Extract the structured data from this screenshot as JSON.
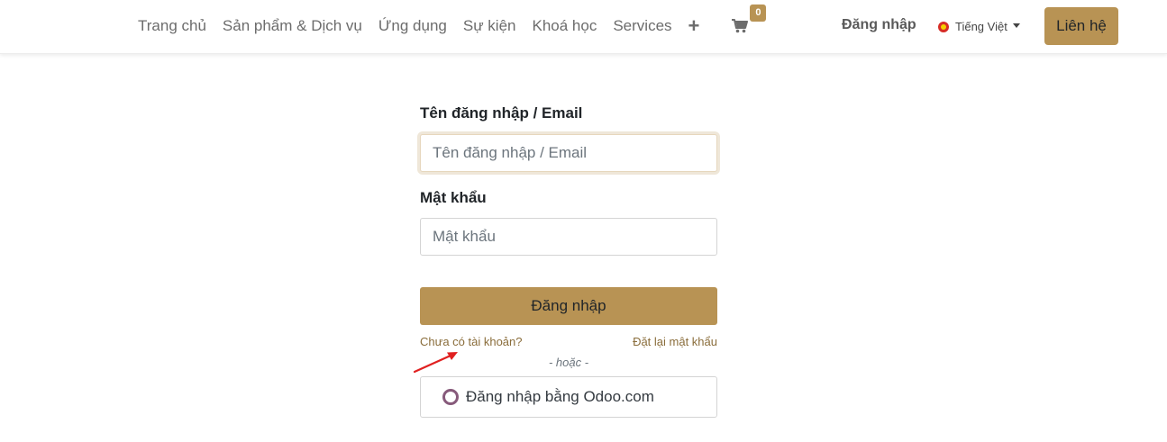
{
  "header": {
    "nav": [
      {
        "label": "Trang chủ"
      },
      {
        "label": "Sản phẩm & Dịch vụ"
      },
      {
        "label": "Ứng dụng"
      },
      {
        "label": "Sự kiện"
      },
      {
        "label": "Khoá học"
      },
      {
        "label": "Services"
      }
    ],
    "plus_icon": "plus-icon",
    "cart": {
      "icon": "cart-icon",
      "count": "0"
    },
    "login_label": "Đăng nhập",
    "language": {
      "label": "Tiếng Việt",
      "flag_icon": "vietnam-flag-icon"
    },
    "contact_label": "Liên hệ"
  },
  "form": {
    "username": {
      "label": "Tên đăng nhập / Email",
      "placeholder": "Tên đăng nhập / Email",
      "value": ""
    },
    "password": {
      "label": "Mật khẩu",
      "placeholder": "Mật khẩu",
      "value": ""
    },
    "submit_label": "Đăng nhập",
    "signup_link": "Chưa có tài khoản?",
    "reset_link": "Đặt lại mật khẩu",
    "or_text": "- hoặc -",
    "oauth_label": "Đăng nhập bằng Odoo.com"
  },
  "colors": {
    "accent": "#b89354",
    "link": "#8a6d3b",
    "odoo_icon": "#875a7b",
    "annotation_arrow": "#e02020"
  }
}
